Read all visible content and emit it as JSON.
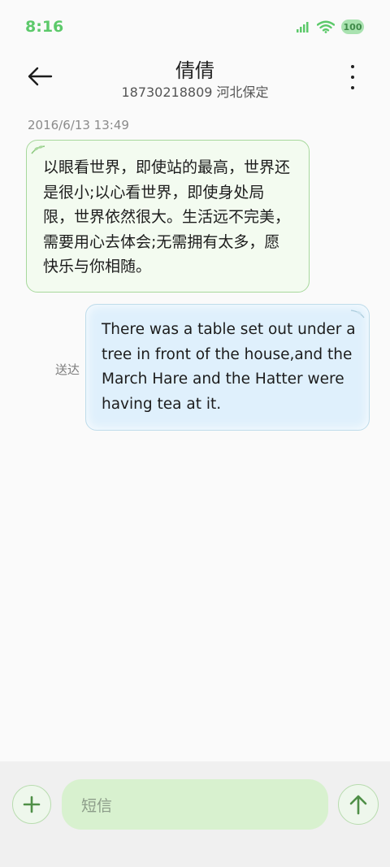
{
  "status_bar": {
    "time": "8:16",
    "battery": "100"
  },
  "header": {
    "title": "倩倩",
    "subtitle": "18730218809 河北保定"
  },
  "conversation": {
    "timestamp": "2016/6/13 13:49",
    "incoming_message": "以眼看世界，即使站的最高，世界还是很小;以心看世界，即使身处局限，世界依然很大。生活远不完美，需要用心去体会;无需拥有太多，愿快乐与你相随。",
    "outgoing_message": "There was a table set out under a tree in front of the house,and the March Hare and the Hatter were having tea at it.",
    "delivery_status": "送达"
  },
  "composer": {
    "placeholder": "短信"
  },
  "colors": {
    "accent_green": "#5cc96a",
    "incoming_bg": "#f3fbf0",
    "outgoing_bg": "#dff0fc",
    "input_bg": "#d8f1cf"
  },
  "icons": {
    "back": "arrow-left-icon",
    "menu": "more-vertical-icon",
    "add": "plus-icon",
    "send": "arrow-up-icon"
  }
}
